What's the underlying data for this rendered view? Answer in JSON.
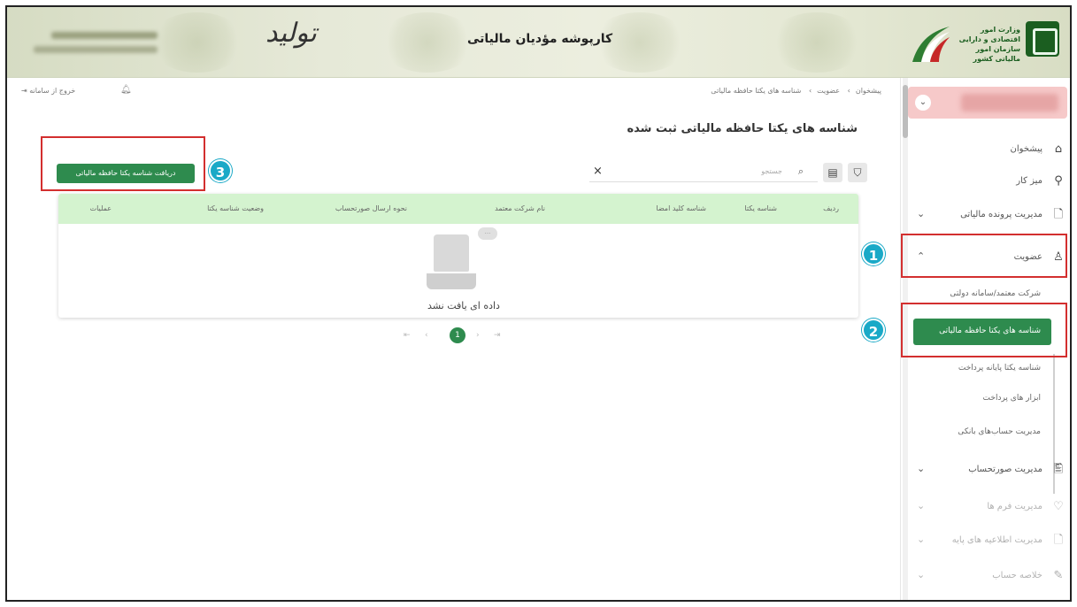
{
  "header": {
    "title": "کارپوشه مؤدیان مالیاتی",
    "calligraphy": "تولید",
    "logo_text": "وزارت امور اقتصادی و دارایی سازمان امور مالیاتی کشور"
  },
  "topbar": {
    "breadcrumb": [
      "پیشخوان",
      "عضویت",
      "شناسه های یکتا حافظه مالیاتی"
    ],
    "logout_label": "خروج از سامانه"
  },
  "page": {
    "title": "شناسه های یکتا حافظه مالیاتی ثبت شده",
    "download_button": "دریافت شناسه یکتا حافظه مالیاتی",
    "search_placeholder": "جستجو"
  },
  "table": {
    "columns": [
      "ردیف",
      "شناسه یکتا",
      "شناسه کلید امضا",
      "نام شرکت معتمد",
      "نحوه ارسال صورتحساب",
      "وضعیت شناسه یکتا",
      "عملیات"
    ],
    "empty_message": "داده ای یافت نشد"
  },
  "pagination": {
    "current": "1"
  },
  "sidebar": {
    "items": [
      {
        "label": "پیشخوان",
        "icon": "home-icon"
      },
      {
        "label": "میز کار",
        "icon": "desk-icon"
      },
      {
        "label": "مدیریت پرونده مالیاتی",
        "icon": "file-icon"
      },
      {
        "label": "عضویت",
        "icon": "user-icon"
      },
      {
        "label": "مدیریت صورتحساب",
        "icon": "invoice-icon"
      },
      {
        "label": "مدیریت فرم ها",
        "icon": "form-icon"
      },
      {
        "label": "مدیریت اطلاعیه های پایه",
        "icon": "notice-icon"
      },
      {
        "label": "خلاصه حساب",
        "icon": "summary-icon"
      }
    ],
    "sub_items": [
      "شرکت معتمد/سامانه دولتی",
      "شناسه های یکتا حافظه مالیاتی",
      "شناسه یکتا پایانه پرداخت",
      "ابزار های پرداخت",
      "مدیریت حساب‌های بانکی"
    ]
  },
  "annotations": [
    "1",
    "2",
    "3"
  ],
  "colors": {
    "accent": "#2e8b4e",
    "table_header": "#d4f3cf",
    "annotation_red": "#d32f2f",
    "badge": "#1aa9c7"
  }
}
